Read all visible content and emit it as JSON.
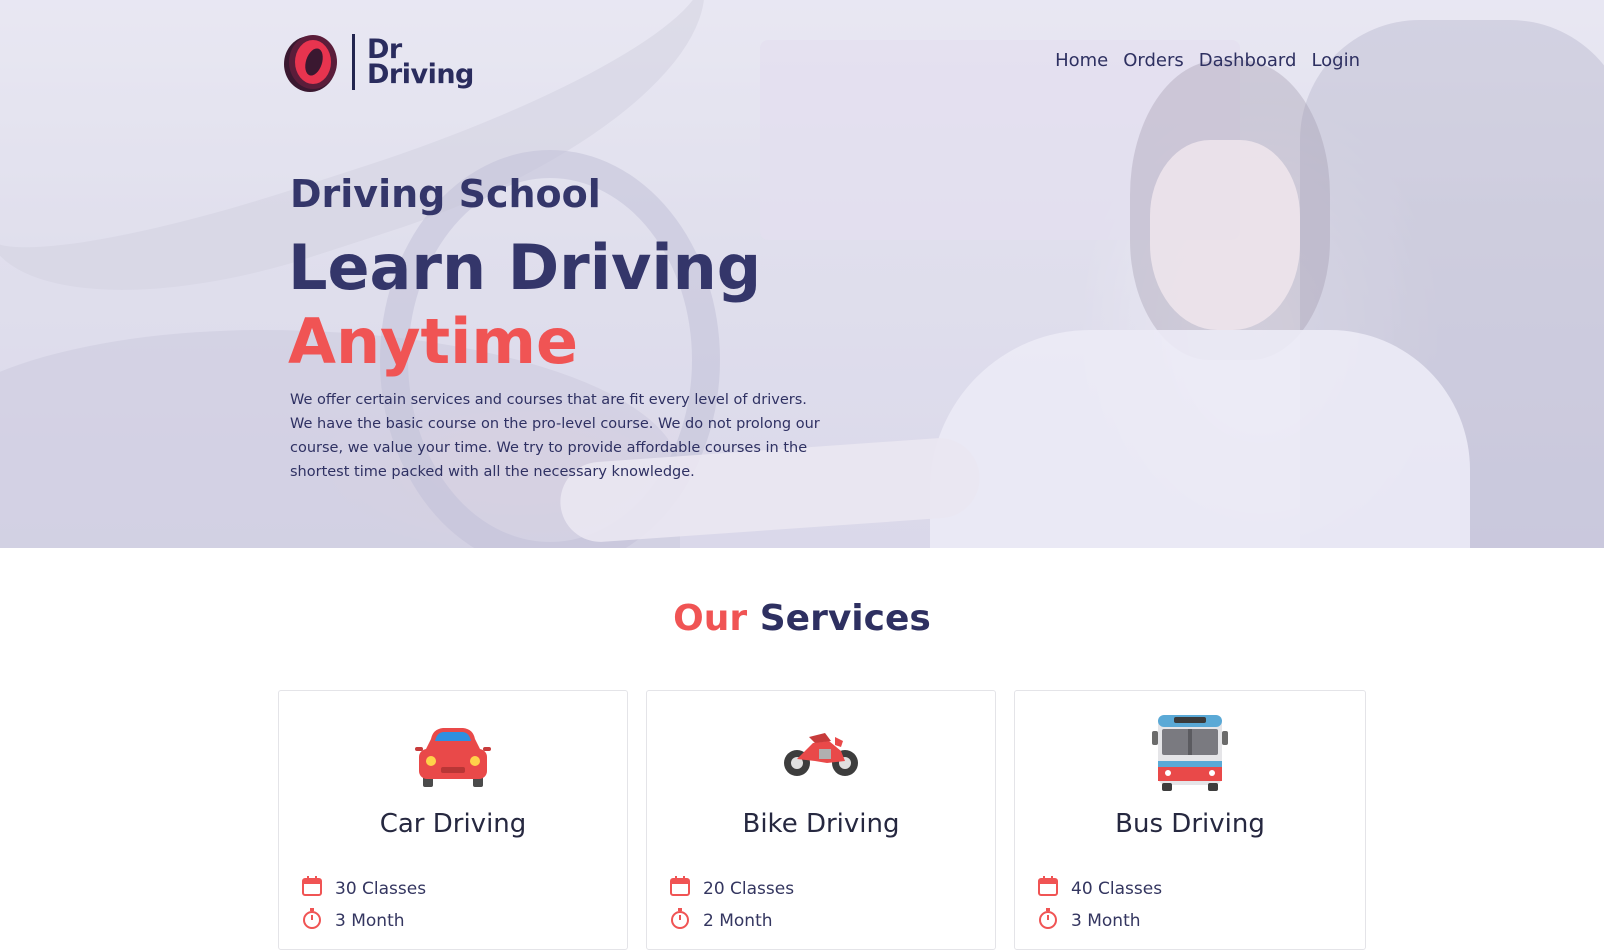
{
  "brand": {
    "line1": "Dr",
    "line2": "Driving"
  },
  "nav": {
    "items": [
      "Home",
      "Orders",
      "Dashboard",
      "Login"
    ]
  },
  "hero": {
    "subtitle": "Driving School",
    "title": "Learn Driving",
    "accent": "Anytime",
    "description": "We offer certain services and courses that are fit every level of drivers. We have the basic course on the pro-level course. We do not prolong our course, we value your time. We try to provide affordable courses in the shortest time packed with all the necessary knowledge."
  },
  "services": {
    "title_accent": "Our",
    "title_rest": "Services",
    "cards": [
      {
        "icon": "car-icon",
        "title": "Car Driving",
        "classes": "30 Classes",
        "duration": "3 Month"
      },
      {
        "icon": "motorcycle-icon",
        "title": "Bike Driving",
        "classes": "20 Classes",
        "duration": "2 Month"
      },
      {
        "icon": "bus-icon",
        "title": "Bus Driving",
        "classes": "40 Classes",
        "duration": "3 Month"
      }
    ]
  },
  "colors": {
    "accent": "#f05454",
    "primary": "#2e3061"
  }
}
